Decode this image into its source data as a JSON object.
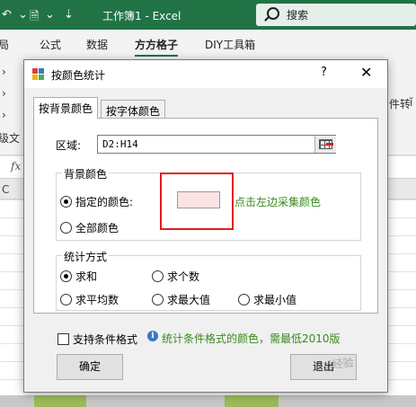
{
  "excel": {
    "doc_title": "工作簿1 - Excel",
    "search_placeholder": "搜索",
    "ribbon_tabs": [
      "局",
      "公式",
      "数据",
      "方方格子",
      "DIY工具箱"
    ],
    "ribbon_left_fragments": [
      "级文"
    ],
    "ribbon_right_fragments": [
      "件转",
      "ĭ"
    ],
    "column_header_fragment": "C",
    "formula_icon": "fx"
  },
  "dialog": {
    "title": "按颜色统计",
    "help_glyph": "?",
    "close_glyph": "✕",
    "tabs": [
      {
        "label": "按背景颜色",
        "active": true
      },
      {
        "label": "按字体颜色",
        "active": false
      }
    ],
    "range": {
      "label": "区域:",
      "value": "D2:H14"
    },
    "background_group": {
      "title": "背景颜色",
      "options": [
        {
          "label": "指定的颜色:",
          "selected": true
        },
        {
          "label": "全部颜色",
          "selected": false
        }
      ],
      "swatch_color": "#fce4e4",
      "hint": "点击左边采集颜色"
    },
    "stat_group": {
      "title": "统计方式",
      "options": [
        {
          "label": "求和",
          "selected": true
        },
        {
          "label": "求个数",
          "selected": false
        },
        {
          "label": "求平均数",
          "selected": false
        },
        {
          "label": "求最大值",
          "selected": false
        },
        {
          "label": "求最小值",
          "selected": false
        }
      ]
    },
    "conditional_format": {
      "label": "支持条件格式",
      "checked": false
    },
    "info_text": "统计条件格式的颜色，需最低2010版",
    "buttons": {
      "ok": "确定",
      "exit": "退出"
    }
  },
  "colors": {
    "excel_green": "#217346",
    "highlight_red": "#e21b1b",
    "hint_green": "#3a8a1e"
  },
  "watermark": "Bai经验"
}
